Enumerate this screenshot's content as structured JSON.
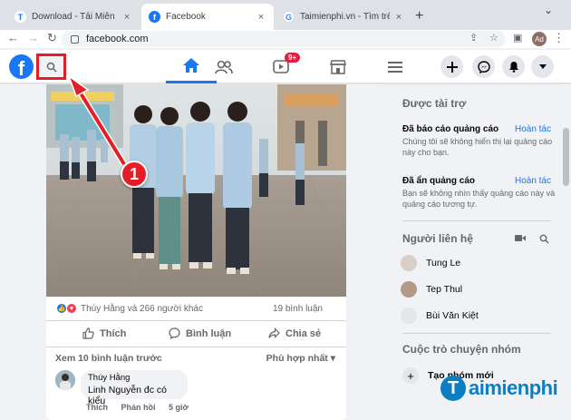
{
  "browser": {
    "tabs": [
      {
        "title": "Download - Tải Miễn Phí VN",
        "favicon_letter": "T",
        "favicon_color": "#1a73e8",
        "active": false
      },
      {
        "title": "Facebook",
        "favicon_letter": "f",
        "favicon_color": "#1877f2",
        "active": true
      },
      {
        "title": "Taimienphi.vn - Tìm trên Goo",
        "favicon_letter": "G",
        "favicon_color": "#ffffff",
        "active": false
      }
    ],
    "close_glyph": "×",
    "new_tab_glyph": "+",
    "url": "facebook.com",
    "profile_initials": "Ad"
  },
  "fb": {
    "logo_letter": "f",
    "brand_color": "#1877f2",
    "badge_count": "9+"
  },
  "post": {
    "reaction_text": "Thúy Hằng và 266 người khác",
    "comment_count": "19 bình luận",
    "actions": {
      "like": "Thích",
      "comment": "Bình luận",
      "share": "Chia sẻ"
    },
    "view_prev": "Xem 10 bình luận trước",
    "sort": "Phù hợp nhất",
    "comment": {
      "author": "Thúy Hằng",
      "text": "Linh Nguyễn đc có kiểu",
      "like": "Thích",
      "reply": "Phản hồi",
      "time": "5 giờ"
    }
  },
  "annotation": {
    "step": "1"
  },
  "sidebar": {
    "sponsored_title": "Được tài trợ",
    "ads": [
      {
        "title": "Đã báo cáo quảng cáo",
        "undo": "Hoàn tác",
        "desc": "Chúng tôi sẽ không hiển thị lại quảng cáo này cho bạn."
      },
      {
        "title": "Đã ẩn quảng cáo",
        "undo": "Hoàn tác",
        "desc": "Bạn sẽ không nhìn thấy quảng cáo này và quảng cáo tương tự."
      }
    ],
    "contacts_title": "Người liên hệ",
    "contacts": [
      "Tung Le",
      "Tep Thul",
      "Bùi Văn Kiệt"
    ],
    "groups_title": "Cuộc trò chuyện nhóm",
    "new_group": "Tạo nhóm mới"
  },
  "watermark": {
    "letter": "T",
    "text": "aimienphi"
  },
  "colors": {
    "accent": "#1877f2",
    "annotation_red": "#e41e26",
    "reaction_like": "#1877f2",
    "reaction_love": "#f33e58"
  },
  "icons": [
    "home-icon",
    "friends-icon",
    "watch-icon",
    "marketplace-icon",
    "menu-icon",
    "plus-icon",
    "messenger-icon",
    "notification-icon",
    "account-caret-icon",
    "search-icon"
  ]
}
